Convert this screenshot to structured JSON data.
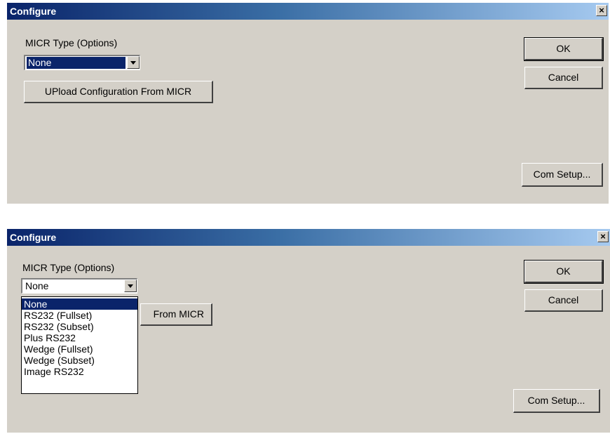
{
  "dialog1": {
    "title": "Configure",
    "close_label": "×",
    "micr_label": "MICR Type (Options)",
    "micr_value": "None",
    "upload_label": "UPload Configuration From MICR",
    "ok_label": "OK",
    "cancel_label": "Cancel",
    "com_setup_label": "Com Setup..."
  },
  "dialog2": {
    "title": "Configure",
    "close_label": "×",
    "micr_label": "MICR Type (Options)",
    "micr_value": "None",
    "upload_label_visible": "From MICR",
    "ok_label": "OK",
    "cancel_label": "Cancel",
    "com_setup_label": "Com Setup...",
    "dropdown_options": [
      "None",
      "RS232 (Fullset)",
      "RS232 (Subset)",
      "Plus RS232",
      "Wedge (Fullset)",
      "Wedge (Subset)",
      "Image RS232"
    ],
    "selected_option": "None"
  },
  "colors": {
    "title_start": "#0a246a",
    "title_end": "#a6caf0",
    "dialog_bg": "#d4d0c8",
    "selection": "#0a246a"
  }
}
